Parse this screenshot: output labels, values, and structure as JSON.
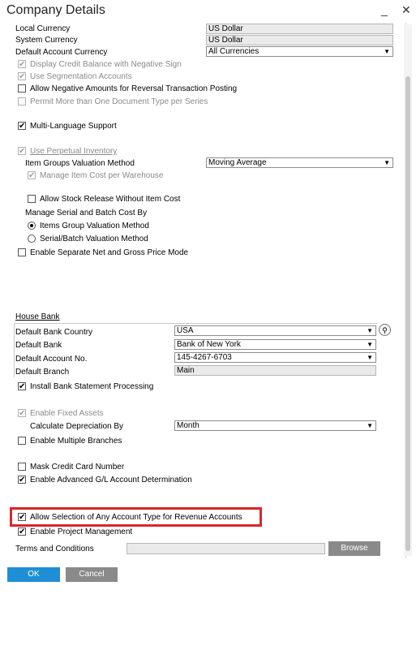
{
  "window": {
    "title": "Company Details",
    "minimize": "_",
    "close": "✕"
  },
  "top": {
    "local_currency_label": "Local Currency",
    "local_currency_value": "US Dollar",
    "system_currency_label": "System Currency",
    "system_currency_value": "US Dollar",
    "default_account_currency_label": "Default Account Currency",
    "default_account_currency_value": "All Currencies"
  },
  "options": {
    "display_credit": "Display Credit Balance with Negative Sign",
    "use_segmentation": "Use Segmentation Accounts",
    "allow_negative": "Allow Negative Amounts for Reversal Transaction Posting",
    "permit_more": "Permit More than One Document Type per Series",
    "multi_language": "Multi-Language Support",
    "use_perpetual": "Use Perpetual Inventory",
    "item_groups_label": "Item Groups Valuation Method",
    "item_groups_value": "Moving Average",
    "manage_item_cost": "Manage Item Cost per Warehouse",
    "allow_stock_release": "Allow Stock Release Without Item Cost",
    "manage_serial_label": "Manage Serial and Batch Cost By",
    "radio_items_group": "Items Group Valuation Method",
    "radio_serial_batch": "Serial/Batch Valuation Method",
    "enable_separate": "Enable Separate Net and Gross Price Mode"
  },
  "house_bank": {
    "heading": "House Bank",
    "country_label": "Default Bank Country",
    "country_value": "USA",
    "bank_label": "Default Bank",
    "bank_value": "Bank of New York",
    "account_label": "Default Account No.",
    "account_value": "145-4267-6703",
    "branch_label": "Default Branch",
    "branch_value": "Main",
    "install_statement": "Install Bank Statement Processing"
  },
  "assets": {
    "enable_fixed": "Enable Fixed Assets",
    "calc_depreciation_label": "Calculate Depreciation By",
    "calc_depreciation_value": "Month",
    "enable_branches": "Enable Multiple Branches",
    "mask_credit": "Mask Credit Card Number",
    "enable_advanced_gl": "Enable Advanced G/L Account Determination",
    "allow_selection": "Allow Selection of Any Account Type for Revenue Accounts",
    "enable_project": "Enable Project Management",
    "terms_label": "Terms and Conditions",
    "browse": "Browse"
  },
  "footer": {
    "ok": "OK",
    "cancel": "Cancel"
  },
  "colors": {
    "accent": "#1e8fd5",
    "highlight": "#d9262c",
    "cancel": "#8a8a8a"
  }
}
